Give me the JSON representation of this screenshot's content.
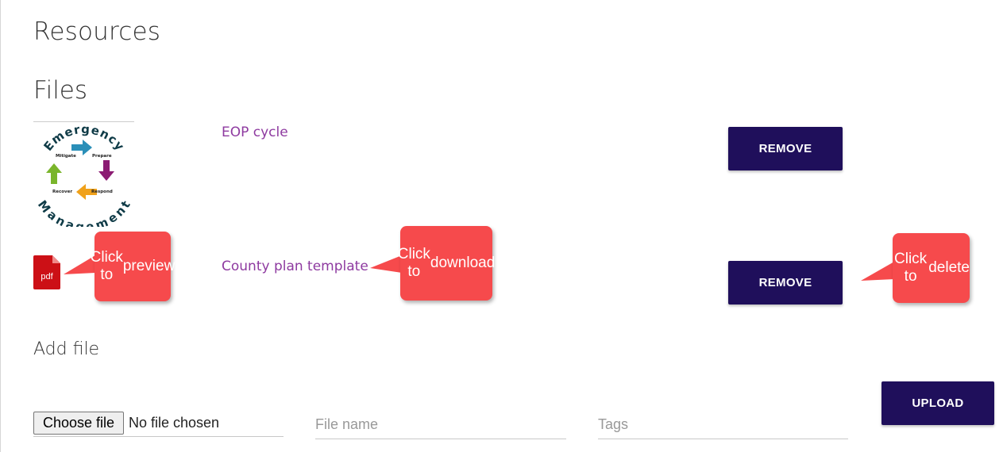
{
  "page": {
    "title": "Resources",
    "files_heading": "Files",
    "add_file_heading": "Add file"
  },
  "files": [
    {
      "name": "EOP cycle",
      "remove_label": "REMOVE",
      "thumbnail": {
        "icon": "emergency-management-cycle-image",
        "text_top": "Emergency",
        "text_bottom": "Management",
        "stages": [
          "Mitigate",
          "Prepare",
          "Respond",
          "Recover"
        ]
      }
    },
    {
      "name": "County plan template",
      "remove_label": "REMOVE",
      "thumbnail": {
        "icon": "pdf-icon",
        "label": "pdf"
      }
    }
  ],
  "callouts": {
    "preview": "Click to preview",
    "download": "Click to download",
    "delete": "Click to delete"
  },
  "add_file": {
    "choose_label": "Choose file",
    "no_file_text": "No file chosen",
    "file_name_placeholder": "File name",
    "tags_placeholder": "Tags",
    "upload_label": "UPLOAD"
  },
  "colors": {
    "button": "#1f0f5b",
    "link": "#8e3aa0",
    "callout": "#f64a4c",
    "pdf": "#cc1016"
  }
}
